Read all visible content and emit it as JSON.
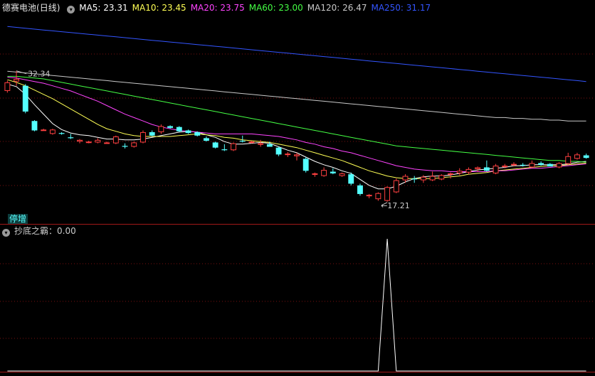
{
  "header": {
    "stock_name": "德赛电池",
    "period": "(日线)",
    "ma_labels": [
      {
        "label": "MA5: 23.31",
        "color": "#ffffff"
      },
      {
        "label": "MA10: 23.45",
        "color": "#ffff55"
      },
      {
        "label": "MA20: 23.75",
        "color": "#ff44ff"
      },
      {
        "label": "MA60: 23.00",
        "color": "#44ff44"
      },
      {
        "label": "MA120: 26.47",
        "color": "#c8c8c8"
      },
      {
        "label": "MA250: 31.17",
        "color": "#3355ff"
      }
    ]
  },
  "colors": {
    "up": "#ff4040",
    "down": "#54ffff",
    "border": "#a01818",
    "grid": "#7a1010",
    "signal": "#ffffff"
  },
  "badge": {
    "label": "停增"
  },
  "indicator": {
    "title": "抄底之霸：0.00"
  },
  "chart_data": [
    {
      "type": "candlestick",
      "annotations": {
        "high": "32.34",
        "low": "17.21"
      },
      "ohlc": [
        [
          30.0,
          31.2,
          29.8,
          31.0
        ],
        [
          31.1,
          32.34,
          30.6,
          31.4
        ],
        [
          30.6,
          30.8,
          27.4,
          27.6
        ],
        [
          26.5,
          26.6,
          25.3,
          25.4
        ],
        [
          25.5,
          25.6,
          25.4,
          25.5
        ],
        [
          25.0,
          25.6,
          24.9,
          25.5
        ],
        [
          25.1,
          25.2,
          24.9,
          25.0
        ],
        [
          24.6,
          25.0,
          24.4,
          24.5
        ],
        [
          24.1,
          24.4,
          23.9,
          24.3
        ],
        [
          24.0,
          24.2,
          23.9,
          24.1
        ],
        [
          24.0,
          24.5,
          23.9,
          24.3
        ],
        [
          24.0,
          24.1,
          23.9,
          24.0
        ],
        [
          23.9,
          24.8,
          23.8,
          24.7
        ],
        [
          23.6,
          23.9,
          23.3,
          23.5
        ],
        [
          23.5,
          24.1,
          23.4,
          24.0
        ],
        [
          24.0,
          25.4,
          23.9,
          25.2
        ],
        [
          25.2,
          25.4,
          24.7,
          24.8
        ],
        [
          25.2,
          26.1,
          25.0,
          25.9
        ],
        [
          25.9,
          26.0,
          25.6,
          25.7
        ],
        [
          25.8,
          25.9,
          25.2,
          25.3
        ],
        [
          25.4,
          25.5,
          25.0,
          25.1
        ],
        [
          25.2,
          25.3,
          24.7,
          24.8
        ],
        [
          24.5,
          24.7,
          24.1,
          24.2
        ],
        [
          24.0,
          24.1,
          23.3,
          23.4
        ],
        [
          23.2,
          23.8,
          23.0,
          23.1
        ],
        [
          23.1,
          24.0,
          23.0,
          23.9
        ],
        [
          24.2,
          24.8,
          24.0,
          24.1
        ],
        [
          24.0,
          24.2,
          23.9,
          24.1
        ],
        [
          23.8,
          24.3,
          23.5,
          23.9
        ],
        [
          23.8,
          24.1,
          23.6,
          23.5
        ],
        [
          23.4,
          23.5,
          22.4,
          22.6
        ],
        [
          22.7,
          22.9,
          22.3,
          22.7
        ],
        [
          22.4,
          22.8,
          21.9,
          22.6
        ],
        [
          22.1,
          22.3,
          20.5,
          20.7
        ],
        [
          20.3,
          20.5,
          20.0,
          20.4
        ],
        [
          20.1,
          21.1,
          20.0,
          20.8
        ],
        [
          20.6,
          21.0,
          20.3,
          20.4
        ],
        [
          20.1,
          20.5,
          20.0,
          20.4
        ],
        [
          20.3,
          20.5,
          19.0,
          19.2
        ],
        [
          19.0,
          19.2,
          17.8,
          18.0
        ],
        [
          17.9,
          18.0,
          17.5,
          17.9
        ],
        [
          17.4,
          18.2,
          17.21,
          18.1
        ],
        [
          17.2,
          18.9,
          17.1,
          18.8
        ],
        [
          18.2,
          19.8,
          18.1,
          19.6
        ],
        [
          19.6,
          20.3,
          19.3,
          20.1
        ],
        [
          19.8,
          20.1,
          19.3,
          19.7
        ],
        [
          19.6,
          20.2,
          19.3,
          20.0
        ],
        [
          19.6,
          20.6,
          19.5,
          20.1
        ],
        [
          19.7,
          20.3,
          19.6,
          20.2
        ],
        [
          20.3,
          20.5,
          19.8,
          20.4
        ],
        [
          20.4,
          21.0,
          20.2,
          20.7
        ],
        [
          20.5,
          21.1,
          20.3,
          20.9
        ],
        [
          20.9,
          21.2,
          20.6,
          21.1
        ],
        [
          21.1,
          21.9,
          20.6,
          20.7
        ],
        [
          20.4,
          21.5,
          20.3,
          21.3
        ],
        [
          21.2,
          21.5,
          21.0,
          21.3
        ],
        [
          21.5,
          21.7,
          21.2,
          21.5
        ],
        [
          21.4,
          21.6,
          21.2,
          21.3
        ],
        [
          21.1,
          21.9,
          21.0,
          21.6
        ],
        [
          21.6,
          21.8,
          21.3,
          21.4
        ],
        [
          21.5,
          21.6,
          21.3,
          21.2
        ],
        [
          21.1,
          21.7,
          21.0,
          21.6
        ],
        [
          21.5,
          22.8,
          21.4,
          22.4
        ],
        [
          22.1,
          22.8,
          22.0,
          22.6
        ],
        [
          22.5,
          22.7,
          22.1,
          22.2
        ]
      ],
      "ma": {
        "MA5": [
          30.8,
          30.5,
          29.6,
          28.4,
          27.3,
          26.2,
          25.5,
          25.1,
          24.9,
          24.8,
          24.6,
          24.4,
          24.4,
          24.3,
          24.3,
          24.4,
          24.6,
          24.8,
          25.0,
          25.2,
          25.3,
          25.2,
          24.9,
          24.6,
          24.1,
          23.8,
          23.8,
          23.9,
          24.0,
          23.9,
          23.5,
          23.1,
          22.8,
          22.3,
          21.8,
          21.4,
          21.1,
          20.7,
          20.4,
          19.7,
          19.0,
          18.6,
          18.6,
          18.9,
          19.4,
          19.8,
          20.0,
          20.1,
          20.1,
          20.2,
          20.4,
          20.6,
          20.8,
          20.9,
          21.0,
          21.1,
          21.3,
          21.3,
          21.4,
          21.4,
          21.4,
          21.4,
          21.5,
          21.7,
          21.8
        ],
        "MA10": [
          31.3,
          31.0,
          30.6,
          30.1,
          29.6,
          29.1,
          28.5,
          27.9,
          27.3,
          26.7,
          26.1,
          25.6,
          25.3,
          25.0,
          24.8,
          24.7,
          24.7,
          24.7,
          24.7,
          24.8,
          24.9,
          25.0,
          24.9,
          24.8,
          24.6,
          24.5,
          24.3,
          24.2,
          24.1,
          24.0,
          23.8,
          23.6,
          23.4,
          23.1,
          22.8,
          22.5,
          22.2,
          21.9,
          21.5,
          21.1,
          20.7,
          20.4,
          20.1,
          19.9,
          19.8,
          19.8,
          19.8,
          19.8,
          19.9,
          20.0,
          20.1,
          20.3,
          20.4,
          20.5,
          20.7,
          20.8,
          20.9,
          21.0,
          21.1,
          21.2,
          21.3,
          21.3,
          21.4,
          21.5,
          21.6
        ],
        "MA20": [
          31.6,
          31.5,
          31.3,
          31.1,
          30.9,
          30.6,
          30.3,
          30.0,
          29.6,
          29.2,
          28.8,
          28.3,
          27.8,
          27.3,
          26.9,
          26.5,
          26.1,
          25.8,
          25.6,
          25.4,
          25.3,
          25.2,
          25.1,
          25.0,
          25.0,
          25.0,
          25.0,
          25.0,
          24.9,
          24.8,
          24.7,
          24.5,
          24.3,
          24.0,
          23.8,
          23.5,
          23.3,
          23.0,
          22.8,
          22.5,
          22.2,
          21.9,
          21.6,
          21.3,
          21.1,
          20.9,
          20.8,
          20.7,
          20.7,
          20.6,
          20.6,
          20.6,
          20.6,
          20.6,
          20.7,
          20.7,
          20.8,
          20.9,
          21.0,
          21.0,
          21.1,
          21.2,
          21.3,
          21.4,
          21.5
        ],
        "MA60": [
          31.7,
          31.7,
          31.6,
          31.5,
          31.4,
          31.2,
          31.0,
          30.8,
          30.6,
          30.4,
          30.2,
          30.0,
          29.8,
          29.6,
          29.4,
          29.2,
          29.0,
          28.8,
          28.6,
          28.4,
          28.2,
          28.0,
          27.8,
          27.6,
          27.4,
          27.2,
          27.0,
          26.8,
          26.6,
          26.4,
          26.2,
          26.0,
          25.8,
          25.6,
          25.4,
          25.2,
          25.0,
          24.8,
          24.6,
          24.4,
          24.2,
          24.0,
          23.8,
          23.6,
          23.5,
          23.4,
          23.3,
          23.2,
          23.1,
          23.0,
          22.9,
          22.8,
          22.7,
          22.6,
          22.5,
          22.4,
          22.3,
          22.2,
          22.1,
          22.0,
          21.9,
          21.9,
          21.8,
          21.8,
          21.7
        ],
        "MA120": [
          32.3,
          32.2,
          32.1,
          32.0,
          31.9,
          31.8,
          31.7,
          31.6,
          31.5,
          31.4,
          31.3,
          31.2,
          31.1,
          31.0,
          30.9,
          30.8,
          30.7,
          30.6,
          30.5,
          30.4,
          30.3,
          30.2,
          30.1,
          30.0,
          29.9,
          29.8,
          29.7,
          29.6,
          29.5,
          29.4,
          29.3,
          29.2,
          29.1,
          29.0,
          28.9,
          28.8,
          28.7,
          28.6,
          28.5,
          28.4,
          28.3,
          28.2,
          28.1,
          28.0,
          27.9,
          27.8,
          27.7,
          27.6,
          27.5,
          27.4,
          27.3,
          27.2,
          27.1,
          27.0,
          26.9,
          26.9,
          26.8,
          26.8,
          26.7,
          26.7,
          26.6,
          26.6,
          26.5,
          26.5,
          26.5
        ],
        "MA250": [
          37.5,
          37.4,
          37.3,
          37.2,
          37.1,
          37.0,
          36.9,
          36.8,
          36.7,
          36.6,
          36.5,
          36.4,
          36.3,
          36.2,
          36.1,
          36.0,
          35.9,
          35.8,
          35.7,
          35.6,
          35.5,
          35.4,
          35.3,
          35.2,
          35.1,
          35.0,
          34.9,
          34.8,
          34.7,
          34.6,
          34.5,
          34.4,
          34.3,
          34.2,
          34.1,
          34.0,
          33.9,
          33.8,
          33.7,
          33.6,
          33.5,
          33.4,
          33.3,
          33.2,
          33.1,
          33.0,
          32.9,
          32.8,
          32.7,
          32.6,
          32.5,
          32.4,
          32.3,
          32.2,
          32.1,
          32.0,
          31.9,
          31.8,
          31.7,
          31.6,
          31.5,
          31.4,
          31.3,
          31.2,
          31.1
        ]
      }
    },
    {
      "type": "line",
      "series": [
        {
          "values": [
            0,
            0,
            0,
            0,
            0,
            0,
            0,
            0,
            0,
            0,
            0,
            0,
            0,
            0,
            0,
            0,
            0,
            0,
            0,
            0,
            0,
            0,
            0,
            0,
            0,
            0,
            0,
            0,
            0,
            0,
            0,
            0,
            0,
            0,
            0,
            0,
            0,
            0,
            0,
            0,
            0,
            0,
            1,
            0,
            0,
            0,
            0,
            0,
            0,
            0,
            0,
            0,
            0,
            0,
            0,
            0,
            0,
            0,
            0,
            0,
            0,
            0,
            0,
            0,
            0
          ]
        }
      ],
      "ylim": [
        0,
        1
      ]
    }
  ]
}
